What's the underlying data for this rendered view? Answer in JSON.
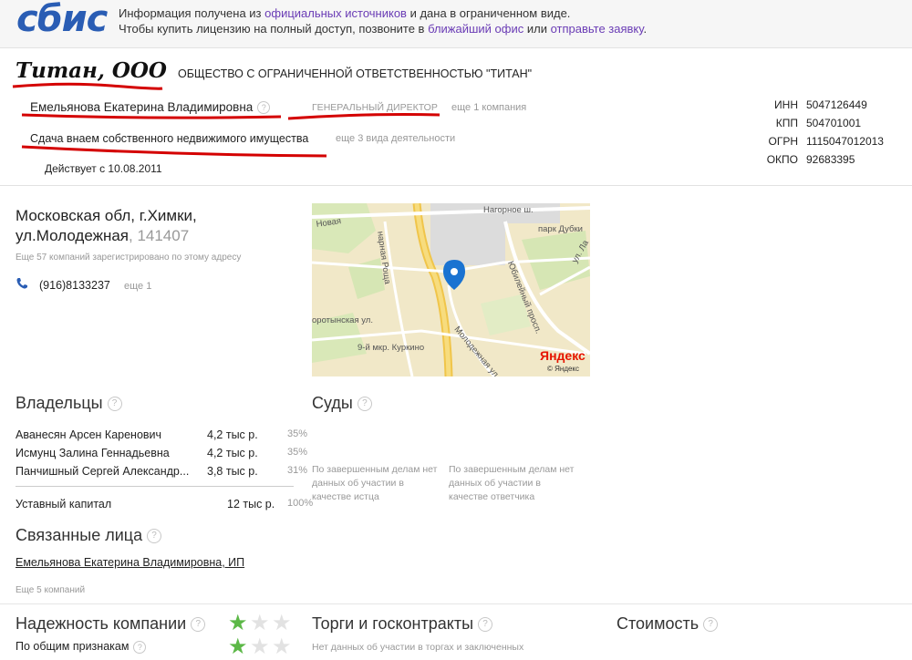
{
  "header": {
    "logo": "сбис",
    "info_line1_a": "Информация получена из ",
    "info_line1_link": "официальных источников",
    "info_line1_b": " и дана в ограниченном виде.",
    "info_line2_a": "Чтобы купить лицензию на полный доступ, позвоните в ",
    "info_line2_link1": "ближайший офис",
    "info_line2_mid": " или ",
    "info_line2_link2": "отправьте заявку",
    "info_line2_end": "."
  },
  "company": {
    "short_name": "Титан, ООО",
    "full_name": "ОБЩЕСТВО С ОГРАНИЧЕННОЙ ОТВЕТСТВЕННОСТЬЮ \"ТИТАН\"",
    "director": "Емельянова Екатерина Владимировна",
    "director_role": "ГЕНЕРАЛЬНЫЙ ДИРЕКТОР",
    "director_more": "еще 1 компания",
    "activity": "Сдача внаем собственного недвижимого имущества",
    "activity_more": "еще 3 вида деятельности",
    "active_since": "Действует с 10.08.2011",
    "ids": [
      {
        "label": "ИНН",
        "value": "5047126449"
      },
      {
        "label": "КПП",
        "value": "504701001"
      },
      {
        "label": "ОГРН",
        "value": "1115047012013"
      },
      {
        "label": "ОКПО",
        "value": "92683395"
      }
    ]
  },
  "address": {
    "line1": "Московская обл, г.Химки,",
    "line2": "ул.Молодежная",
    "zip": ", 141407",
    "registered": "Еще 57 компаний зарегистрировано по этому адресу",
    "phone": "(916)8133237",
    "phone_more": "еще 1"
  },
  "map": {
    "labels": [
      "Нагорное ш.",
      "парк Дубки",
      "Юбилейный просп.",
      "ул. Ла",
      "оротынская ул.",
      "9-й мкр. Куркино",
      "Молодежная ул.",
      "Новая",
      "нарная Роща"
    ],
    "logo": "Яндекс",
    "copyright": "© Яндекс"
  },
  "owners": {
    "title": "Владельцы",
    "rows": [
      {
        "name": "Аванесян Арсен Каренович",
        "amount": "4,2 тыс р.",
        "pct": "35%"
      },
      {
        "name": "Исмунц Залина Геннадьевна",
        "amount": "4,2 тыс р.",
        "pct": "35%"
      },
      {
        "name": "Панчишный Сергей Александр...",
        "amount": "3,8 тыс р.",
        "pct": "31%"
      }
    ],
    "capital_label": "Уставный капитал",
    "capital_amount": "12 тыс р.",
    "capital_pct": "100%"
  },
  "courts": {
    "title": "Суды",
    "plaintiff": "По завершенным делам нет данных об участии в качестве истца",
    "defendant": "По завершенным делам нет данных об участии в качестве ответчика"
  },
  "related": {
    "title": "Связанные лица",
    "person": "Емельянова Екатерина Владимировна, ИП",
    "more": "Еще 5 компаний"
  },
  "bottom": {
    "reliability_title": "Надежность компании",
    "reliability_sub": "По общим признакам",
    "reliability_stars": 1,
    "trades_title": "Торги и госконтракты",
    "trades_sub": "Нет данных об участии в торгах и заключенных",
    "cost_title": "Стоимость"
  },
  "colors": {
    "link": "#6a3cb5",
    "logo": "#2a5db4",
    "underline": "#d40000",
    "star_on": "#5cb847",
    "star_off": "#e2e2e2"
  }
}
